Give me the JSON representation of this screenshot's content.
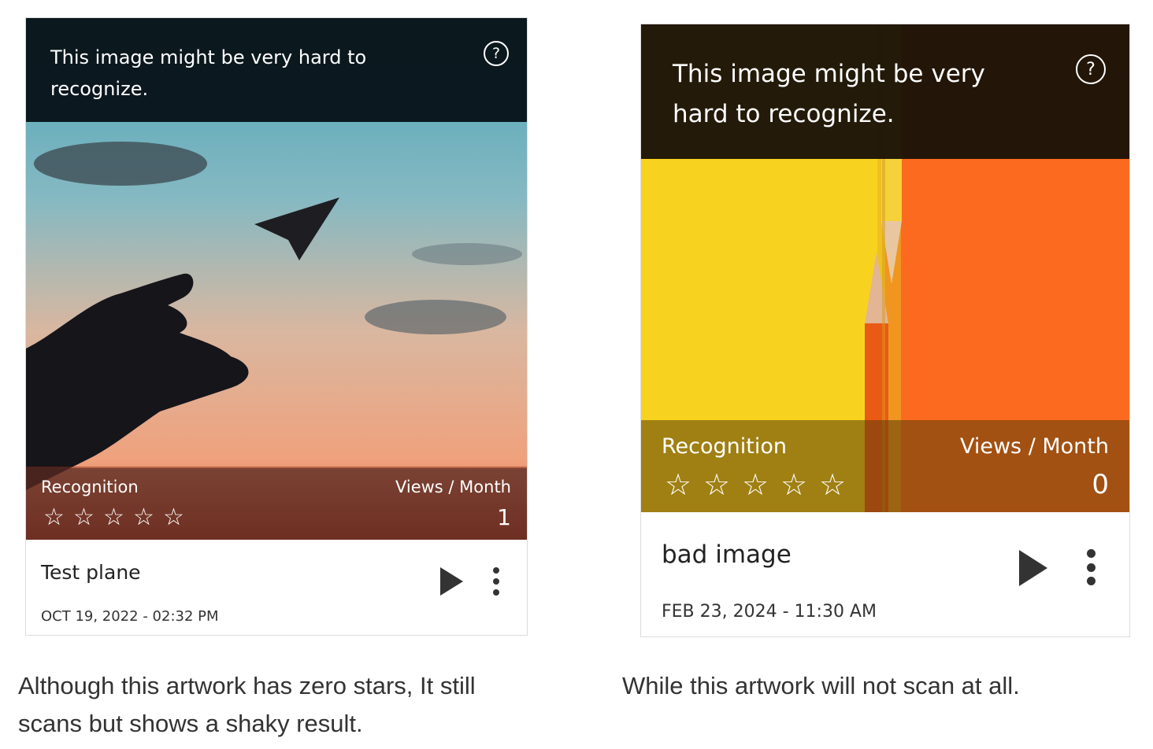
{
  "cards": [
    {
      "warning": "This image might be very hard to recognize.",
      "recognition_label": "Recognition",
      "views_label": "Views / Month",
      "views_value": "1",
      "stars_filled": 0,
      "stars_total": 5,
      "title": "Test plane",
      "date": "OCT 19, 2022 - 02:32 PM",
      "help_icon": "question-circle-icon",
      "play_icon": "play-icon",
      "menu_icon": "kebab-menu-icon"
    },
    {
      "warning": "This image might be very hard to recognize.",
      "recognition_label": "Recognition",
      "views_label": "Views / Month",
      "views_value": "0",
      "stars_filled": 0,
      "stars_total": 5,
      "title": "bad image",
      "date": "FEB 23, 2024 - 11:30 AM",
      "help_icon": "question-circle-icon",
      "play_icon": "play-icon",
      "menu_icon": "kebab-menu-icon"
    }
  ],
  "captions": [
    "Although this artwork has zero stars, It still scans but shows a shaky result.",
    "While this artwork will not scan at all."
  ],
  "star_glyph": "☆",
  "help_glyph": "?"
}
